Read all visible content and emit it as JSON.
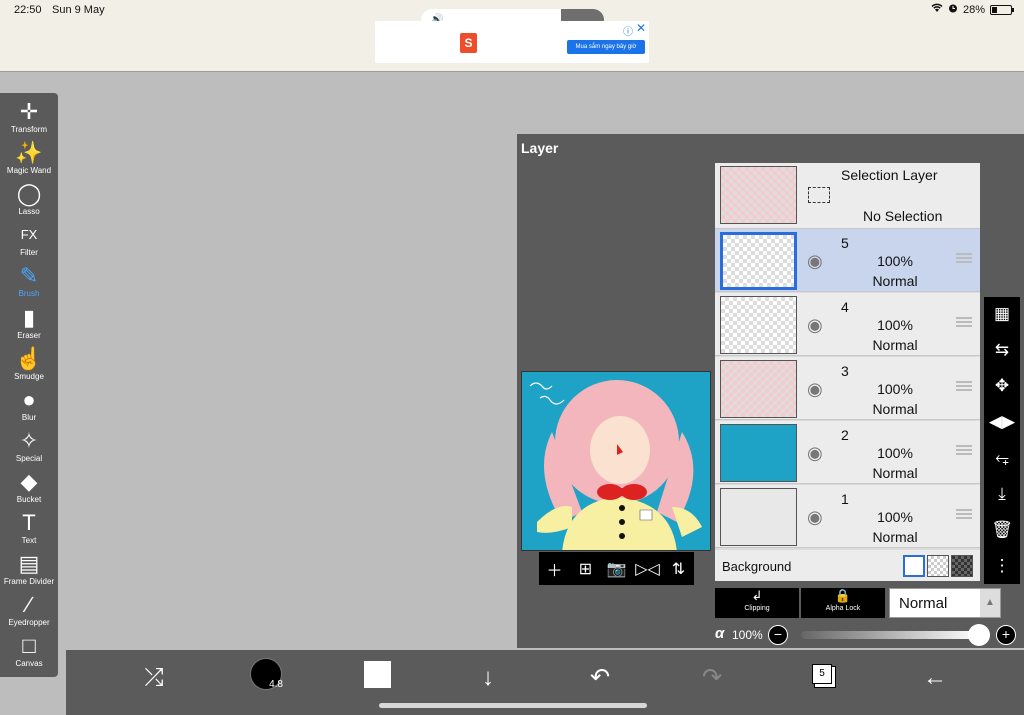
{
  "status": {
    "time": "22:50",
    "date": "Sun 9 May",
    "battery": "28%"
  },
  "ad": {
    "cta": "Mua sắm ngay bây giờ"
  },
  "toolbar": {
    "tools": [
      {
        "label": "Transform",
        "icon": "move-icon"
      },
      {
        "label": "Magic Wand",
        "icon": "magic-wand-icon"
      },
      {
        "label": "Lasso",
        "icon": "lasso-icon"
      },
      {
        "label": "Filter",
        "icon": "fx-icon",
        "icon_text": "FX"
      },
      {
        "label": "Brush",
        "icon": "brush-icon",
        "active": true
      },
      {
        "label": "Eraser",
        "icon": "eraser-icon"
      },
      {
        "label": "Smudge",
        "icon": "smudge-icon"
      },
      {
        "label": "Blur",
        "icon": "drop-icon"
      },
      {
        "label": "Special",
        "icon": "sparkle-icon"
      },
      {
        "label": "Bucket",
        "icon": "bucket-icon"
      },
      {
        "label": "Text",
        "icon": "text-icon",
        "icon_text": "T"
      },
      {
        "label": "Frame Divider",
        "icon": "frame-divider-icon"
      },
      {
        "label": "Eyedropper",
        "icon": "eyedropper-icon"
      },
      {
        "label": "Canvas",
        "icon": "canvas-icon"
      }
    ]
  },
  "layer_panel": {
    "title": "Layer",
    "selection_layer": {
      "title": "Selection Layer",
      "status": "No Selection"
    },
    "layers": [
      {
        "num": "5",
        "opacity": "100%",
        "blend": "Normal",
        "selected": true,
        "thumb": "empty"
      },
      {
        "num": "4",
        "opacity": "100%",
        "blend": "Normal",
        "selected": false,
        "thumb": "lineart"
      },
      {
        "num": "3",
        "opacity": "100%",
        "blend": "Normal",
        "selected": false,
        "thumb": "color"
      },
      {
        "num": "2",
        "opacity": "100%",
        "blend": "Normal",
        "selected": false,
        "thumb": "blue"
      },
      {
        "num": "1",
        "opacity": "100%",
        "blend": "Normal",
        "selected": false,
        "thumb": "sketch"
      }
    ],
    "background_label": "Background",
    "clipping_label": "Clipping",
    "alpha_lock_label": "Alpha Lock",
    "blend_mode": "Normal",
    "alpha_symbol": "α",
    "alpha_value": "100%",
    "alpha_fraction": 1.0
  },
  "bottom_bar": {
    "brush_size": "4.8",
    "layer_count": "5",
    "color": "#ffffff"
  },
  "colors": {
    "accent": "#4aa8ff",
    "selected_layer": "#c9d5ec",
    "panel": "#5b5b5b"
  }
}
